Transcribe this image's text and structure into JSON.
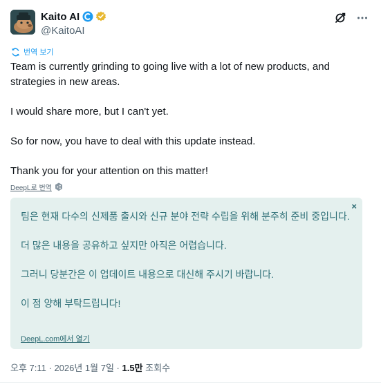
{
  "author": {
    "display_name": "Kaito AI",
    "handle": "@KaitoAI"
  },
  "translate_link": "번역 보기",
  "tweet": {
    "paragraphs": [
      "Team is currently grinding to going live with a lot of new products, and strategies in new areas.",
      "I would share more, but I can't yet.",
      "So for now, you have to deal with this update instead.",
      "Thank you for your attention on this matter!"
    ]
  },
  "deepl_credit": "DeepL로 번역",
  "deepl_box": {
    "close": "×",
    "paragraphs": [
      "팀은 현재 다수의 신제품 출시와 신규 분야 전략 수립을 위해 분주히 준비 중입니다.",
      "더 많은 내용을 공유하고 싶지만 아직은 어렵습니다.",
      "그러니 당분간은 이 업데이트 내용으로 대신해 주시기 바랍니다.",
      "이 점 양해 부탁드립니다!"
    ],
    "open_link": "DeepL.com에서 열기"
  },
  "meta": {
    "time": "오후 7:11",
    "sep1": " · ",
    "date": "2026년 1월 7일",
    "sep2": " · ",
    "views_count": "1.5만",
    "views_label": " 조회수"
  },
  "colors": {
    "link_blue": "#1d9bf0",
    "deepl_bg": "#e4f0ee",
    "deepl_text": "#2e6f77",
    "verified_gold": "#e8b830"
  },
  "icons": {
    "grok": "grok-icon",
    "more": "more-icon",
    "translate": "translate-icon",
    "verified": "verified-badge-icon"
  }
}
